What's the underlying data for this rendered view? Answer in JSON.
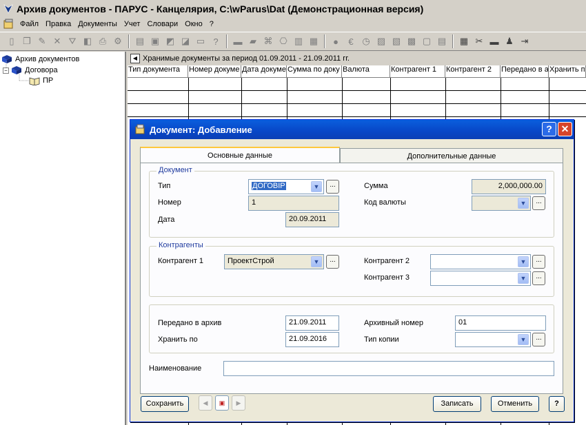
{
  "window": {
    "title": "Архив документов - ПАРУС - Канцелярия, C:\\wParus\\Dat (Демонстрационная версия)"
  },
  "menu": [
    "Файл",
    "Правка",
    "Документы",
    "Учет",
    "Словари",
    "Окно",
    "?"
  ],
  "tree": {
    "root": "Архив документов",
    "child": "Договора",
    "leaf": "ПР"
  },
  "grid": {
    "period": "Хранимые документы за период 01.09.2011 - 21.09.2011 гг.",
    "columns": [
      "Тип документа",
      "Номер докуме",
      "Дата докуме",
      "Сумма по доку",
      "Валюта",
      "Контрагент 1",
      "Контрагент 2",
      "Передано в ар",
      "Хранить по"
    ]
  },
  "dialog": {
    "title": "Документ: Добавление",
    "help": "?",
    "close": "✕",
    "tabs": [
      "Основные данные",
      "Дополнительные данные"
    ],
    "doc_group": {
      "legend": "Документ",
      "type_label": "Тип",
      "type_value": "ДОГОВІР",
      "number_label": "Номер",
      "number_value": "1",
      "date_label": "Дата",
      "date_value": "20.09.2011",
      "sum_label": "Сумма",
      "sum_value": "2,000,000.00",
      "currency_label": "Код валюты",
      "currency_value": ""
    },
    "contr_group": {
      "legend": "Контрагенты",
      "c1_label": "Контрагент 1",
      "c1_value": "ПроектСтрой",
      "c2_label": "Контрагент 2",
      "c2_value": "",
      "c3_label": "Контрагент 3",
      "c3_value": ""
    },
    "archive_group": {
      "transferred_label": "Передано в архив",
      "transferred_value": "21.09.2011",
      "keep_label": "Хранить по",
      "keep_value": "21.09.2016",
      "arch_num_label": "Архивный номер",
      "arch_num_value": "01",
      "copy_type_label": "Тип копии",
      "copy_type_value": ""
    },
    "name_label": "Наименование",
    "name_value": "",
    "buttons": {
      "save": "Сохранить",
      "write": "Записать",
      "cancel": "Отменить",
      "help": "?"
    },
    "ellipsis": "..."
  }
}
